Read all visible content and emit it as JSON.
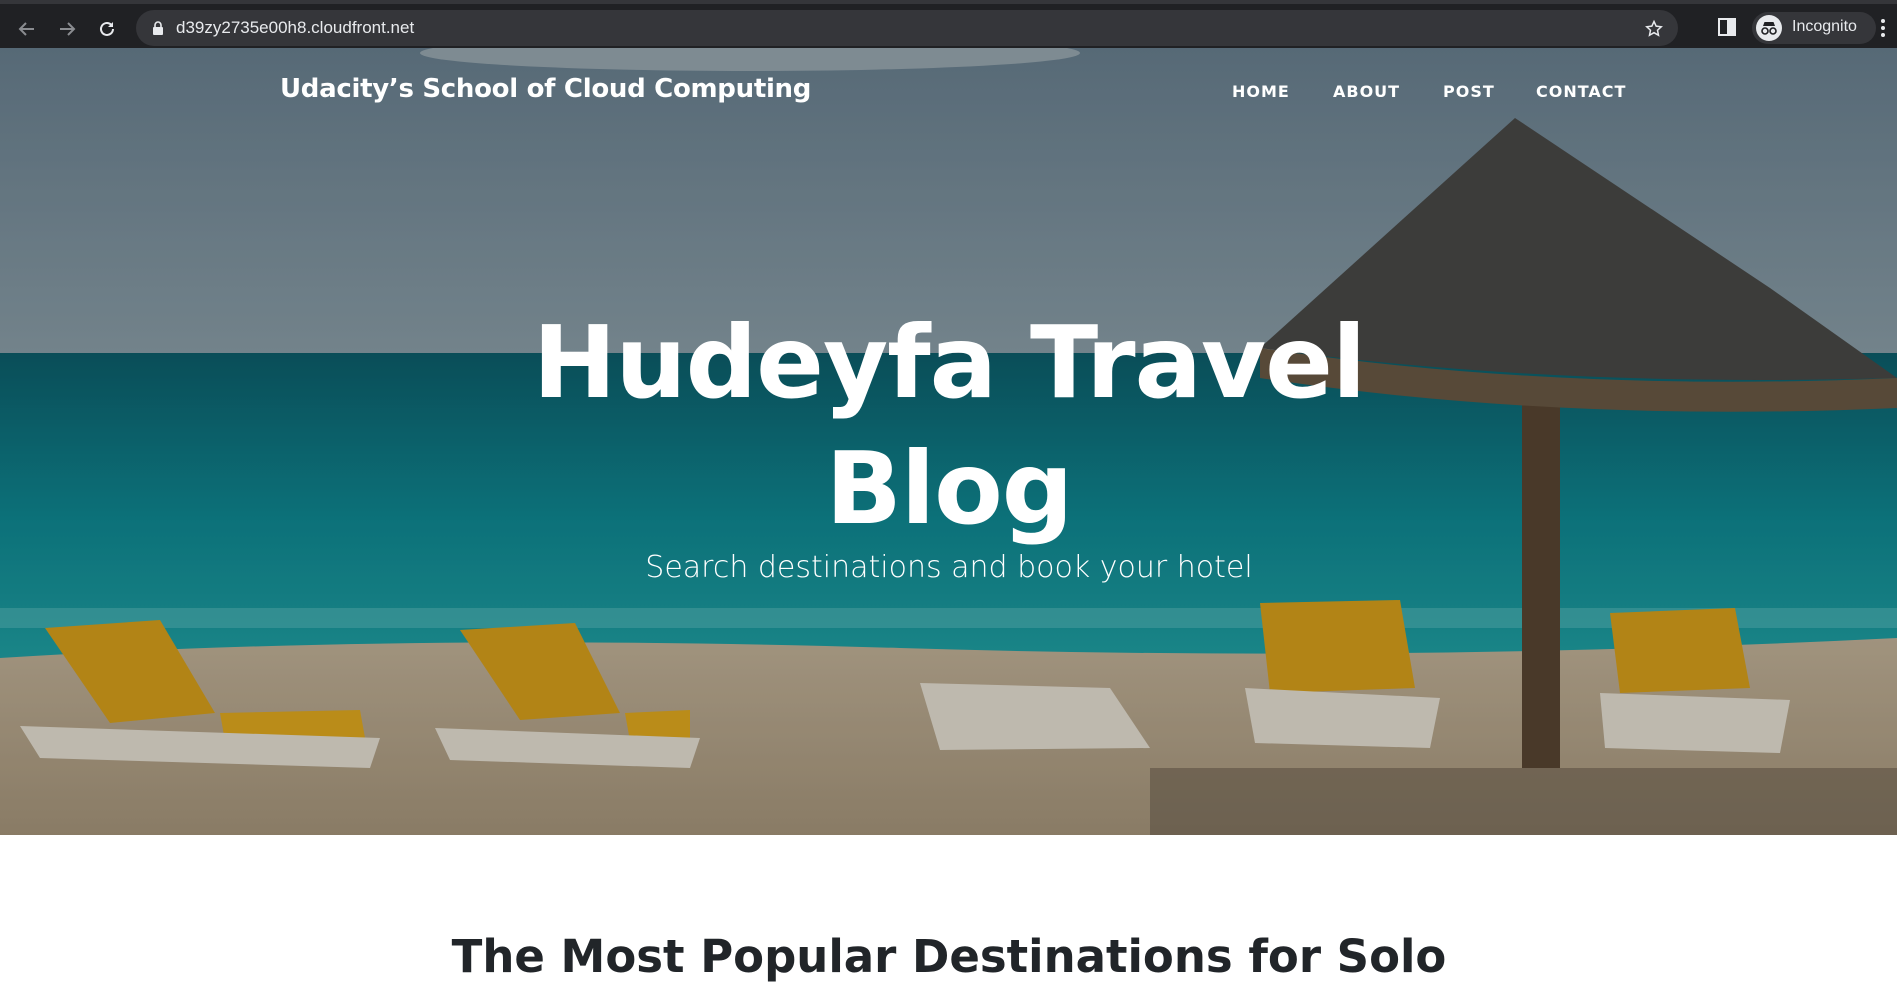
{
  "browser": {
    "url": "d39zy2735e00h8.cloudfront.net",
    "profile_label": "Incognito",
    "icons": [
      "back-icon",
      "forward-icon",
      "reload-icon",
      "lock-icon",
      "star-icon",
      "side-panel-icon",
      "incognito-icon",
      "more-icon"
    ]
  },
  "site": {
    "brand": "Udacity’s School of Cloud Computing",
    "nav": [
      "HOME",
      "ABOUT",
      "POST",
      "CONTACT"
    ]
  },
  "hero": {
    "title": "Hudeyfa Travel Blog",
    "subtitle": "Search destinations and book your hotel"
  },
  "main": {
    "section_title": "The Most Popular Destinations for Solo"
  },
  "colors": {
    "chrome_bg": "#202124",
    "omnibox_bg": "#35363a",
    "heading_text": "#212529"
  }
}
